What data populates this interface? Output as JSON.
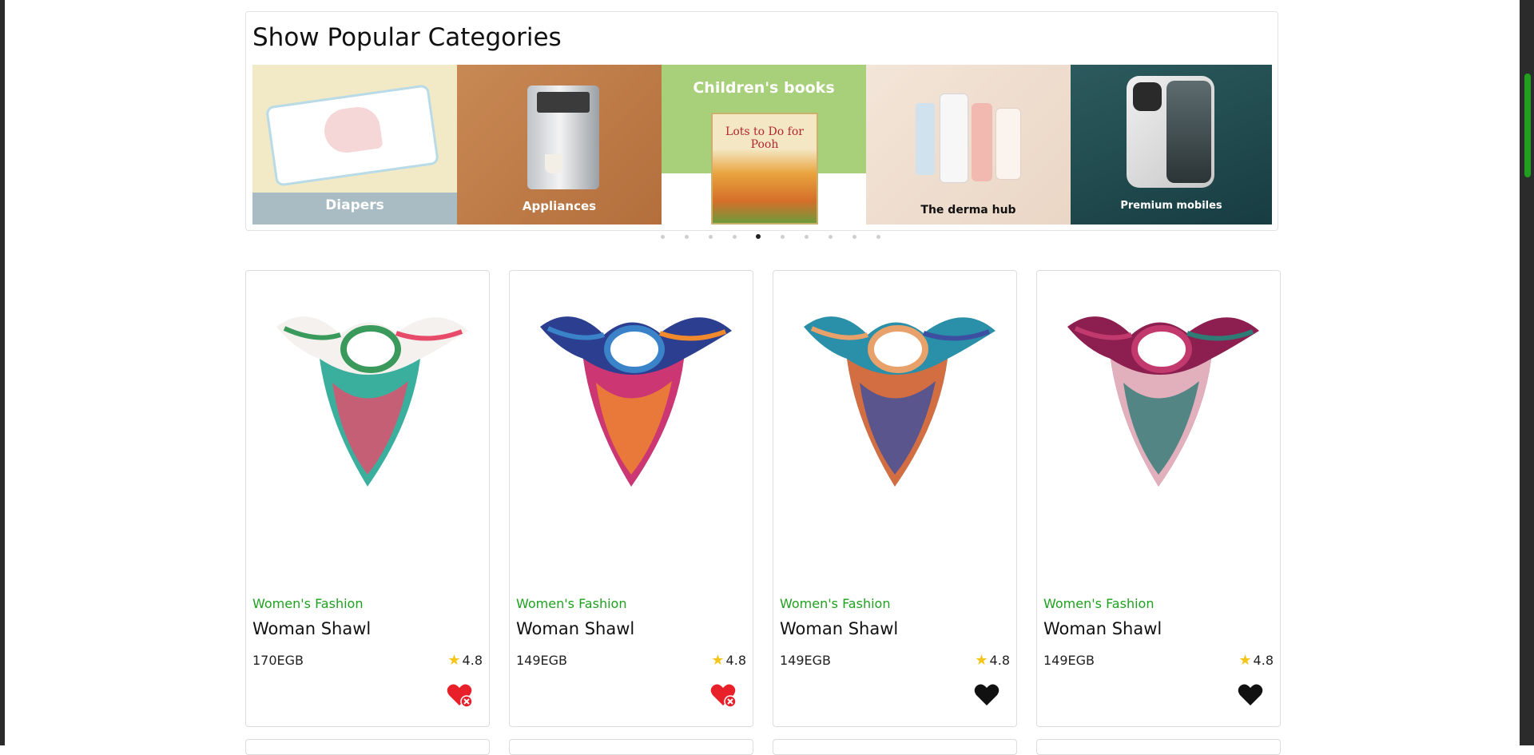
{
  "categories": {
    "title": "Show Popular Categories",
    "slides": [
      {
        "label": "Diapers"
      },
      {
        "label": "Appliances"
      },
      {
        "label": "Children's books",
        "book_title": "Lots to Do for Pooh"
      },
      {
        "label": "The derma hub"
      },
      {
        "label": "Premium mobiles"
      }
    ],
    "dots_total": 10,
    "active_dot": 5
  },
  "products": [
    {
      "category": "Women's Fashion",
      "title": "Woman Shawl",
      "price": "170EGB",
      "rating": "4.8",
      "wishlisted": true
    },
    {
      "category": "Women's Fashion",
      "title": "Woman Shawl",
      "price": "149EGB",
      "rating": "4.8",
      "wishlisted": true
    },
    {
      "category": "Women's Fashion",
      "title": "Woman Shawl",
      "price": "149EGB",
      "rating": "4.8",
      "wishlisted": false
    },
    {
      "category": "Women's Fashion",
      "title": "Woman Shawl",
      "price": "149EGB",
      "rating": "4.8",
      "wishlisted": false
    }
  ],
  "colors": {
    "accent": "#1ea21e",
    "wishlist_active": "#e8202a",
    "wishlist_inactive": "#111111",
    "star": "#f5c518"
  },
  "icons": {
    "rating": "star-icon",
    "wishlist_active": "heart-remove-icon",
    "wishlist_inactive": "heart-icon"
  }
}
